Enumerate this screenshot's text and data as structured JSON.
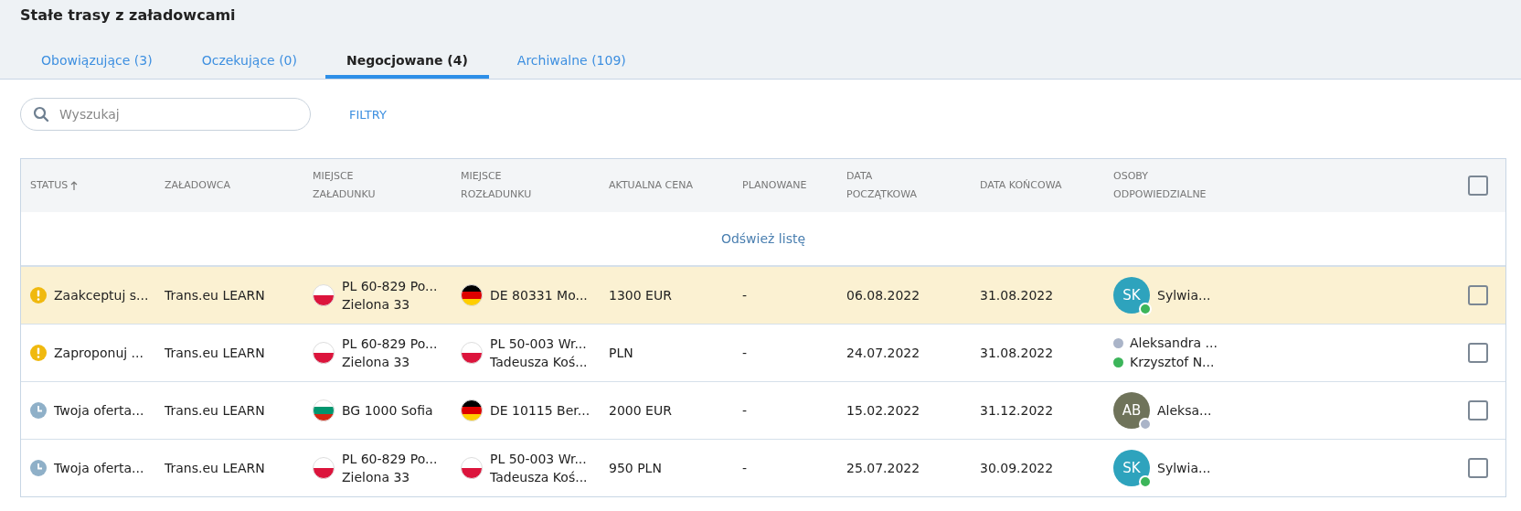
{
  "title": "Stałe trasy z załadowcami",
  "tabs": [
    {
      "label": "Obowiązujące (3)",
      "selected": false
    },
    {
      "label": "Oczekujące (0)",
      "selected": false
    },
    {
      "label": "Negocjowane (4)",
      "selected": true
    },
    {
      "label": "Archiwalne (109)",
      "selected": false
    }
  ],
  "search": {
    "placeholder": "Wyszukaj"
  },
  "filters_button": "FILTRY",
  "table": {
    "columns": [
      {
        "label": "STATUS",
        "sorted": true
      },
      {
        "label": "ZAŁADOWCA",
        "sorted": false
      },
      {
        "label": "MIEJSCE ZAŁADUNKU",
        "sorted": false
      },
      {
        "label": "MIEJSCE ROZŁADUNKU",
        "sorted": false
      },
      {
        "label": "AKTUALNA CENA",
        "sorted": false
      },
      {
        "label": "PLANOWANE",
        "sorted": false
      },
      {
        "label": "DATA POCZĄTKOWA",
        "sorted": false
      },
      {
        "label": "DATA KOŃCOWA",
        "sorted": false
      },
      {
        "label": "OSOBY ODPOWIEDZIALNE",
        "sorted": false
      }
    ],
    "select_all_checked": false,
    "refresh_link": "Odśwież listę",
    "rows": [
      {
        "highlighted": true,
        "checked": false,
        "status": {
          "kind": "warning",
          "text": "Zaakceptuj s..."
        },
        "shipper": "Trans.eu LEARN",
        "loading": {
          "kind": "poland",
          "lines": [
            "PL 60-829 Po...",
            "Zielona 33"
          ]
        },
        "unloading": {
          "kind": "germany",
          "lines": [
            "DE 80331 Mo..."
          ]
        },
        "price": "1300 EUR",
        "planned": "-",
        "start": "06.08.2022",
        "end": "31.08.2022",
        "people": {
          "kind": "avatar",
          "initials": "SK",
          "color": "#2ea3bd",
          "presence": {
            "color": "#3cb55a"
          },
          "name": "Sylwia..."
        }
      },
      {
        "highlighted": false,
        "checked": false,
        "status": {
          "kind": "warning",
          "text": "Zaproponuj ..."
        },
        "shipper": "Trans.eu LEARN",
        "loading": {
          "kind": "poland",
          "lines": [
            "PL 60-829 Po...",
            "Zielona 33"
          ]
        },
        "unloading": {
          "kind": "poland",
          "lines": [
            "PL 50-003 Wr...",
            "Tadeusza Koś..."
          ]
        },
        "price": "PLN",
        "planned": "-",
        "start": "24.07.2022",
        "end": "31.08.2022",
        "people": {
          "kind": "list",
          "items": [
            {
              "name": "Aleksandra ...",
              "color": "#aab4c8"
            },
            {
              "name": "Krzysztof N...",
              "color": "#3cb55a"
            }
          ]
        }
      },
      {
        "highlighted": false,
        "checked": false,
        "status": {
          "kind": "pending",
          "text": "Twoja oferta..."
        },
        "shipper": "Trans.eu LEARN",
        "loading": {
          "kind": "bulgaria",
          "lines": [
            "BG 1000 Sofia"
          ]
        },
        "unloading": {
          "kind": "germany",
          "lines": [
            "DE 10115 Ber..."
          ]
        },
        "price": "2000 EUR",
        "planned": "-",
        "start": "15.02.2022",
        "end": "31.12.2022",
        "people": {
          "kind": "avatar",
          "initials": "AB",
          "color": "#6f735a",
          "presence": {
            "color": "#aab4c8"
          },
          "name": "Aleksa..."
        }
      },
      {
        "highlighted": false,
        "checked": false,
        "status": {
          "kind": "pending",
          "text": "Twoja oferta..."
        },
        "shipper": "Trans.eu LEARN",
        "loading": {
          "kind": "poland",
          "lines": [
            "PL 60-829 Po...",
            "Zielona 33"
          ]
        },
        "unloading": {
          "kind": "poland",
          "lines": [
            "PL 50-003 Wr...",
            "Tadeusza Koś..."
          ]
        },
        "price": "950 PLN",
        "planned": "-",
        "start": "25.07.2022",
        "end": "30.09.2022",
        "people": {
          "kind": "avatar",
          "initials": "SK",
          "color": "#2ea3bd",
          "presence": {
            "color": "#3cb55a"
          },
          "name": "Sylwia..."
        }
      }
    ]
  }
}
